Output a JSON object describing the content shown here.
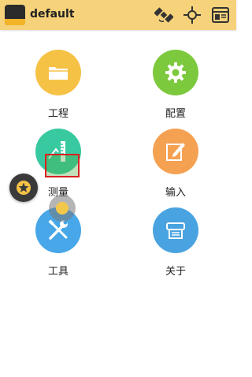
{
  "header": {
    "app_logo": "gps-app-logo",
    "title": "default",
    "icons": [
      "satellite-icon",
      "crosshair-icon",
      "window-panel-icon"
    ]
  },
  "menu": {
    "items": [
      {
        "label": "工程",
        "icon": "folder-icon",
        "color": "#f6c246"
      },
      {
        "label": "配置",
        "icon": "gear-icon",
        "color": "#7dc93e"
      },
      {
        "label": "测量",
        "icon": "ruler-icon",
        "color": "#38c9a0"
      },
      {
        "label": "输入",
        "icon": "edit-icon",
        "color": "#f5a152"
      },
      {
        "label": "工具",
        "icon": "tools-icon",
        "color": "#47a7e8"
      },
      {
        "label": "关于",
        "icon": "about-icon",
        "color": "#49a3e0"
      }
    ]
  },
  "floating": {
    "assist_icon": "star-icon"
  },
  "colors": {
    "topbar": "#f6d27a",
    "background": "#ffffff"
  }
}
